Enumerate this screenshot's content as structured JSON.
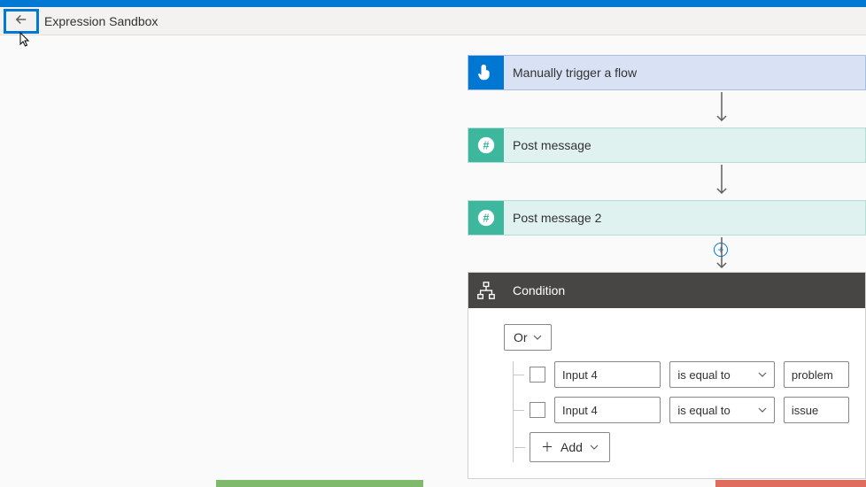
{
  "header": {
    "title": "Expression Sandbox"
  },
  "flow": {
    "trigger": {
      "title": "Manually trigger a flow",
      "icon": "hand-tap-icon"
    },
    "post1": {
      "title": "Post message",
      "icon": "hash-icon"
    },
    "post2": {
      "title": "Post message 2",
      "icon": "hash-icon"
    }
  },
  "condition": {
    "title": "Condition",
    "operator": "Or",
    "add_label": "Add",
    "rows": [
      {
        "left": "Input 4",
        "op": "is equal to",
        "right": "problem"
      },
      {
        "left": "Input 4",
        "op": "is equal to",
        "right": "issue"
      }
    ]
  },
  "colors": {
    "accent": "#0078d4",
    "trigger_icon_bg": "#0077d3",
    "post_icon_bg": "#3eb79f",
    "condition_header_bg": "#484644",
    "yes_branch": "#7fba6c",
    "no_branch": "#e06c5f"
  }
}
